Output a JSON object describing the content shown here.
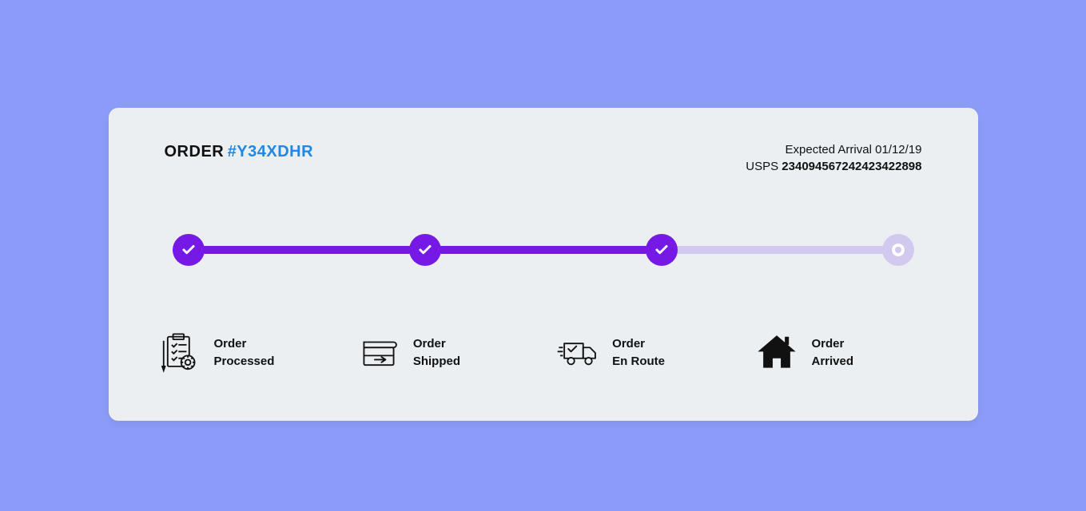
{
  "header": {
    "order_label": "ORDER",
    "order_id": "#Y34XDHR",
    "arrival_label": "Expected Arrival",
    "arrival_date": "01/12/19",
    "carrier": "USPS",
    "tracking_number": "234094567242423422898"
  },
  "steps": [
    {
      "line1": "Order",
      "line2": "Processed"
    },
    {
      "line1": "Order",
      "line2": "Shipped"
    },
    {
      "line1": "Order",
      "line2": "En Route"
    },
    {
      "line1": "Order",
      "line2": "Arrived"
    }
  ]
}
